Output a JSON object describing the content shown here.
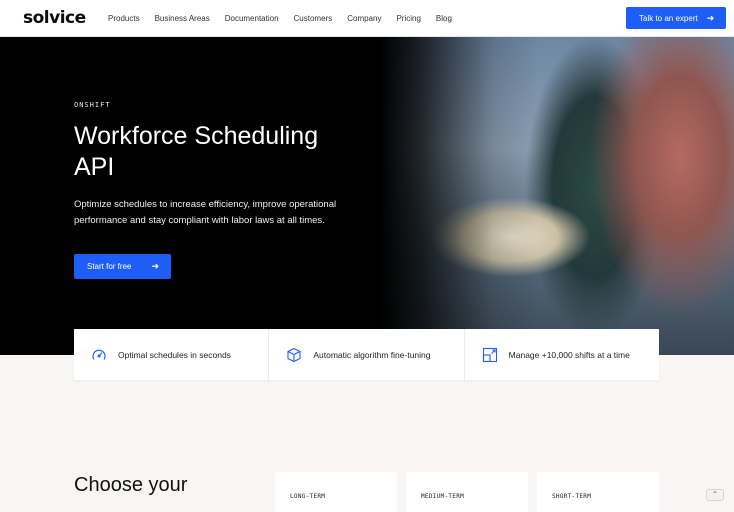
{
  "nav": {
    "logo": "solvice",
    "items": [
      {
        "label": "Products"
      },
      {
        "label": "Business Areas"
      },
      {
        "label": "Documentation"
      },
      {
        "label": "Customers"
      },
      {
        "label": "Company"
      },
      {
        "label": "Pricing"
      },
      {
        "label": "Blog"
      }
    ],
    "cta": "Talk to an expert",
    "cta_icon": "arrow-right-icon"
  },
  "hero": {
    "eyebrow": "ONSHIFT",
    "title_line1": "Workforce Scheduling",
    "title_line2": "API",
    "subtitle": "Optimize schedules to increase efficiency, improve operational performance and stay compliant with labor laws at all times.",
    "cta": "Start for free",
    "cta_icon": "arrow-right-icon"
  },
  "features": [
    {
      "label": "Optimal schedules in seconds",
      "icon": "speedometer-icon"
    },
    {
      "label": "Automatic algorithm fine-tuning",
      "icon": "cube-icon"
    },
    {
      "label": "Manage +10,000 shifts at a time",
      "icon": "expand-grid-icon"
    }
  ],
  "plans_section": {
    "title": "Choose your",
    "plans": [
      {
        "label": "LONG-TERM"
      },
      {
        "label": "MEDIUM-TERM"
      },
      {
        "label": "SHORT-TERM"
      }
    ]
  },
  "scroll_top_icon": "chevron-up-icon",
  "colors": {
    "accent": "#1e5ef7",
    "hero_bg": "#000000",
    "page_bg": "#f7f6f4"
  }
}
